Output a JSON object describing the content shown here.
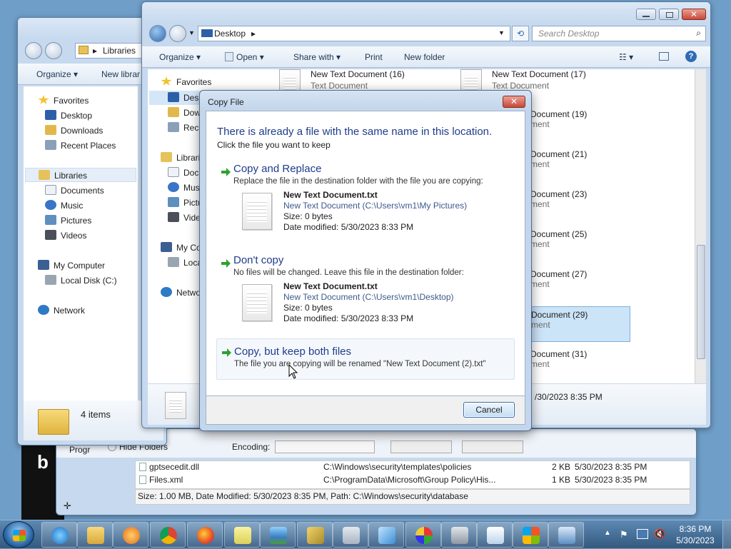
{
  "background_window": {
    "status_text": "Size: 1.00 MB, Date Modified: 5/30/2023 8:35 PM, Path: C:\\Windows\\security\\database",
    "rows": [
      {
        "name": "gptsecedit.dll",
        "path": "C:\\Windows\\security\\templates\\policies",
        "size": "2 KB",
        "date": "5/30/2023 8:35 PM"
      },
      {
        "name": "Files.xml",
        "path": "C:\\ProgramData\\Microsoft\\Group Policy\\His...",
        "size": "1 KB",
        "date": "5/30/2023 8:35 PM"
      }
    ],
    "hide_folders": "Hide Folders",
    "encoding_label": "Encoding:",
    "partial_left": "Progr",
    "partial_ms": "M",
    "partial_letter": "b"
  },
  "libraries_window": {
    "address": "Libraries",
    "toolbar": {
      "organize": "Organize",
      "new_library": "New librar"
    },
    "nav": {
      "favorites": "Favorites",
      "desktop": "Desktop",
      "downloads": "Downloads",
      "recent_places": "Recent Places",
      "libraries": "Libraries",
      "documents": "Documents",
      "music": "Music",
      "pictures": "Pictures",
      "videos": "Videos",
      "my_computer": "My Computer",
      "local_disk": "Local Disk (C:)",
      "network": "Network"
    },
    "status": "4 items"
  },
  "desktop_window": {
    "address": "Desktop",
    "search_placeholder": "Search Desktop",
    "toolbar": {
      "organize": "Organize",
      "open": "Open",
      "share_with": "Share with",
      "print": "Print",
      "new_folder": "New folder"
    },
    "nav": {
      "favorites": "Favorites",
      "desktop": "Desk",
      "downloads": "Dow",
      "recent": "Rece",
      "libraries": "Librari",
      "documents": "Doc",
      "music": "Mus",
      "pictures": "Pictu",
      "videos": "Vide",
      "my_computer": "My Co",
      "local": "Loca",
      "network": "Netwo"
    },
    "files": [
      {
        "name": "New Text Document (16)",
        "type": "Text Document"
      },
      {
        "name": "New Text Document (17)",
        "type": "Text Document"
      },
      {
        "name": "Document (19)",
        "type": "ment"
      },
      {
        "name": "Document (21)",
        "type": "ment"
      },
      {
        "name": "Document (23)",
        "type": "ment"
      },
      {
        "name": "Document (25)",
        "type": "ment"
      },
      {
        "name": "Document (27)",
        "type": "ment"
      },
      {
        "name": "Document (29)",
        "type": "ment"
      },
      {
        "name": "Document (31)",
        "type": "ment"
      }
    ],
    "details_date": "/30/2023 8:35 PM"
  },
  "dialog": {
    "title": "Copy File",
    "heading": "There is already a file with the same name in this location.",
    "subheading": "Click the file you want to keep",
    "options": {
      "replace": {
        "title": "Copy and Replace",
        "desc": "Replace the file in the destination folder with the file you are copying:",
        "file_name": "New Text Document.txt",
        "file_path": "New Text Document (C:\\Users\\vm1\\My Pictures)",
        "size": "Size: 0 bytes",
        "modified": "Date modified: 5/30/2023 8:33 PM"
      },
      "dont_copy": {
        "title": "Don't copy",
        "desc": "No files will be changed. Leave this file in the destination folder:",
        "file_name": "New Text Document.txt",
        "file_path": "New Text Document (C:\\Users\\vm1\\Desktop)",
        "size": "Size: 0 bytes",
        "modified": "Date modified: 5/30/2023 8:33 PM"
      },
      "keep_both": {
        "title": "Copy, but keep both files",
        "desc": "The file you are copying will be renamed \"New Text Document (2).txt\""
      }
    },
    "cancel": "Cancel"
  },
  "taskbar": {
    "time": "8:36 PM",
    "date": "5/30/2023"
  },
  "colors": {
    "accent_blue": "#1e3c8c",
    "selection": "#cce4f7",
    "green_arrow": "#2fa12f",
    "close_red": "#c9483a"
  }
}
